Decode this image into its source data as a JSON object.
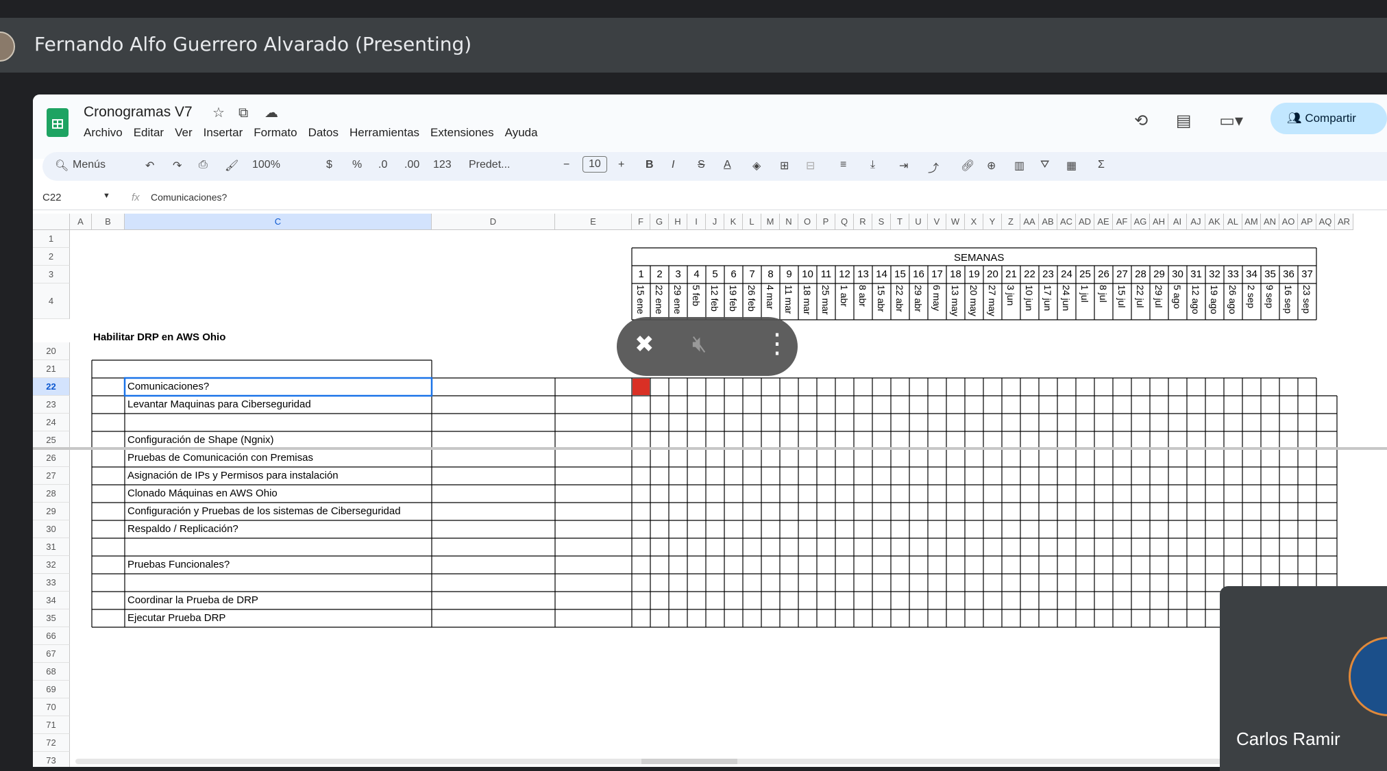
{
  "meet": {
    "presenter": "Fernando Alfo Guerrero Alvarado (Presenting)",
    "participant_name": "Carlos Ramir"
  },
  "sheets": {
    "doc_title": "Cronogramas V7",
    "menu": [
      "Archivo",
      "Editar",
      "Ver",
      "Insertar",
      "Formato",
      "Datos",
      "Herramientas",
      "Extensiones",
      "Ayuda"
    ],
    "share_label": "Compartir",
    "toolbar": {
      "search_label": "Menús",
      "zoom": "100%",
      "currency": "$",
      "percent": "%",
      "dec_dec": ".0",
      "dec_inc": ".00",
      "format_123": "123",
      "font": "Predet...",
      "font_size": "10",
      "bold": "B",
      "italic": "I",
      "strike": "S",
      "text_color": "A",
      "sum": "Σ"
    },
    "formula_bar": {
      "cell_ref": "C22",
      "fx": "fx",
      "content": "Comunicaciones?"
    },
    "columns": [
      "A",
      "B",
      "C",
      "D",
      "E",
      "F",
      "G",
      "H",
      "I",
      "J",
      "K",
      "L",
      "M",
      "N",
      "O",
      "P",
      "Q",
      "R",
      "S",
      "T",
      "U",
      "V",
      "W",
      "X",
      "Y",
      "Z",
      "AA",
      "AB",
      "AC",
      "AD",
      "AE",
      "AF",
      "AG",
      "AH",
      "AI",
      "AJ",
      "AK",
      "AL",
      "AM",
      "AN",
      "AO",
      "AP",
      "AQ",
      "AR"
    ],
    "selected_column": "C",
    "rows": [
      "1",
      "2",
      "3",
      "4",
      "20",
      "21",
      "22",
      "23",
      "24",
      "25",
      "26",
      "27",
      "28",
      "29",
      "30",
      "31",
      "32",
      "33",
      "34",
      "35",
      "66",
      "67",
      "68",
      "69",
      "70",
      "71",
      "72",
      "73"
    ],
    "selected_row": "22",
    "semanas_label": "SEMANAS",
    "week_numbers": [
      "1",
      "2",
      "3",
      "4",
      "5",
      "6",
      "7",
      "8",
      "9",
      "10",
      "11",
      "12",
      "13",
      "14",
      "15",
      "16",
      "17",
      "18",
      "19",
      "20",
      "21",
      "22",
      "23",
      "24",
      "25",
      "26",
      "27",
      "28",
      "29",
      "30",
      "31",
      "32",
      "33",
      "34",
      "35",
      "36",
      "37"
    ],
    "week_dates": [
      "15 ene",
      "22 ene",
      "29 ene",
      "5 feb",
      "12 feb",
      "19 feb",
      "26 feb",
      "4 mar",
      "11 mar",
      "18 mar",
      "25 mar",
      "1 abr",
      "8 abr",
      "15 abr",
      "22 abr",
      "29 abr",
      "6 may",
      "13 may",
      "20 may",
      "27 may",
      "3 jun",
      "10 jun",
      "17 jun",
      "24 jun",
      "1 jul",
      "8 jul",
      "15 jul",
      "22 jul",
      "29 jul",
      "5 ago",
      "12 ago",
      "19 ago",
      "26 ago",
      "2 sep",
      "9 sep",
      "16 sep",
      "23 sep"
    ],
    "section_title": "Habilitar DRP en AWS Ohio",
    "tasks": [
      "Comunicaciones?",
      "Levantar Maquinas para Ciberseguridad",
      "",
      "Configuración de Shape (Ngnix)",
      "Pruebas de Comunicación con Premisas",
      "Asignación de IPs y Permisos para instalación",
      "Clonado Máquinas en AWS Ohio",
      "Configuración y Pruebas de los sistemas de Ciberseguridad",
      "Respaldo / Replicación?",
      "",
      "Pruebas Funcionales?",
      "",
      "Coordinar la Prueba de DRP",
      "Ejecutar Prueba DRP"
    ],
    "highlight_color": "#d93025"
  }
}
